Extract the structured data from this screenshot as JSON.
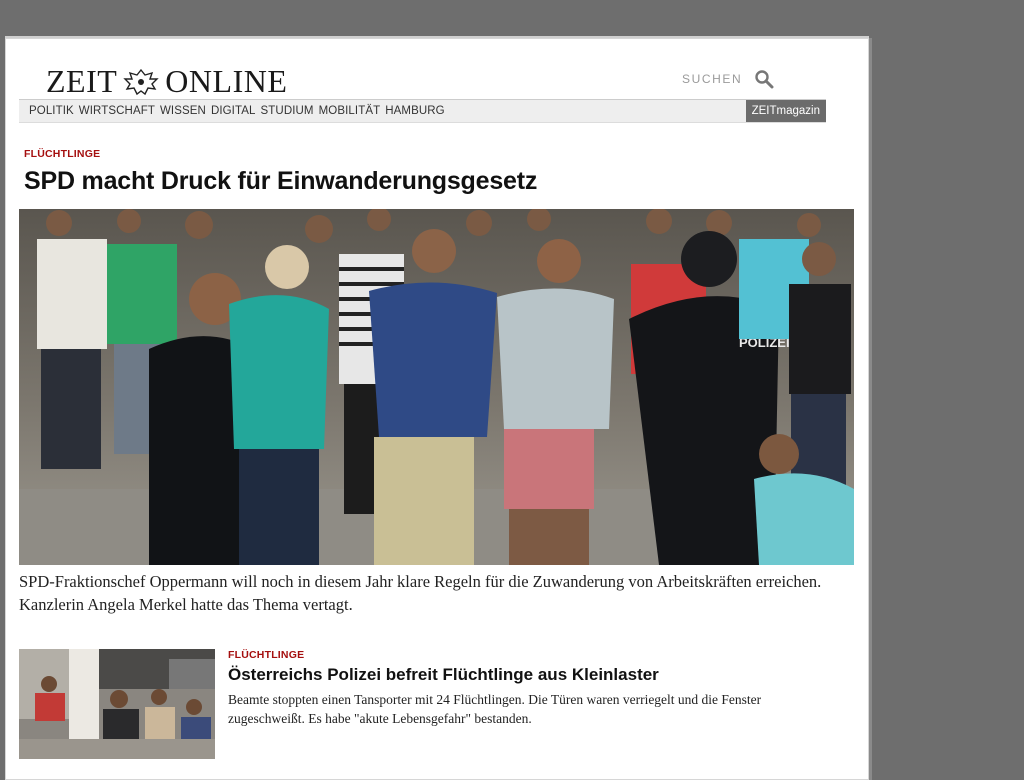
{
  "header": {
    "logo_left": "ZEIT",
    "logo_right": "ONLINE",
    "search_label": "SUCHEN",
    "search_icon": "magnifier-icon"
  },
  "nav": {
    "items": [
      {
        "label": "POLITIK"
      },
      {
        "label": "WIRTSCHAFT"
      },
      {
        "label": "WISSEN"
      },
      {
        "label": "DIGITAL"
      },
      {
        "label": "STUDIUM"
      },
      {
        "label": "MOBILITÄT"
      },
      {
        "label": "HAMBURG"
      }
    ],
    "magazin_label": "ZEITmagazin"
  },
  "main_article": {
    "kicker": "FLÜCHTLINGE",
    "title": "SPD macht Druck für Einwanderungsgesetz",
    "image_alt": "Flüchtlinge und Polizisten",
    "police_label": "POLIZEI",
    "teaser": "SPD-Fraktionschef Oppermann will noch in diesem Jahr klare Regeln für die Zuwanderung von Arbeitskräften erreichen. Kanzlerin Angela Merkel hatte das Thema vertagt."
  },
  "second_article": {
    "kicker": "FLÜCHTLINGE",
    "title": "Österreichs Polizei befreit Flüchtlinge aus Kleinlaster",
    "teaser": "Beamte stoppten einen Tansporter mit 24 Flüchtlingen. Die Türen waren verriegelt und die Fenster zugeschweißt. Es habe \"akute Lebensgefahr\" bestanden."
  },
  "colors": {
    "kicker": "#a50f0f",
    "background_frame": "#6e6e6e",
    "nav_bg": "#eeeeee",
    "magazin_bg": "#6b6b6b"
  }
}
